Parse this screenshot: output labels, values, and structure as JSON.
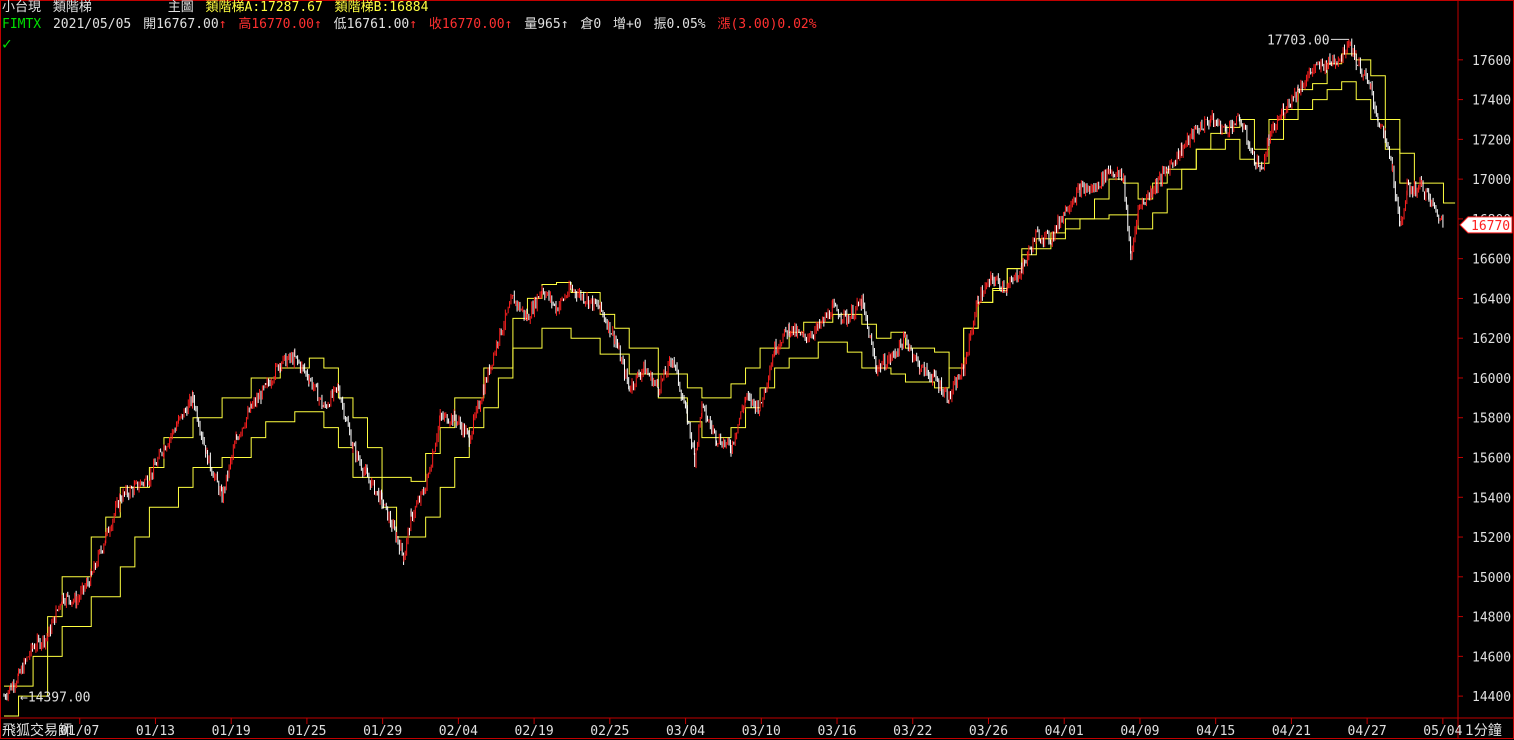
{
  "header": {
    "symbol_name": "小台現",
    "indicator_name": "類階梯",
    "panel_label": "主圖",
    "ladder_a": "類階梯A:17287.67",
    "ladder_b": "類階梯B:16884",
    "code": "FIMTX",
    "date": "2021/05/05",
    "open": "開16767.00",
    "high": "高16770.00",
    "low": "低16761.00",
    "close": "收16770.00",
    "volume": "量965",
    "open_interest": "倉0",
    "oi_change": "增+0",
    "amplitude": "振0.05%",
    "change": "漲(3.00)0.02%",
    "arrow": "↑"
  },
  "footer": {
    "brand": "飛狐交易師",
    "interval": "1分鐘"
  },
  "colors": {
    "background": "#000000",
    "axis": "#c00000",
    "text": "#e0e0e0",
    "up": "#ff2020",
    "down": "#ffffff",
    "ladder": "#ffff40",
    "code": "#00e000"
  },
  "chart_data": {
    "type": "candlestick",
    "title": "小台現 類階梯",
    "ylim": [
      14300,
      17750
    ],
    "y_ticks": [
      14400,
      14600,
      14800,
      15000,
      15200,
      15400,
      15600,
      15800,
      16000,
      16200,
      16400,
      16600,
      16800,
      17000,
      17200,
      17400,
      17600
    ],
    "x_ticks": [
      "01/07",
      "01/13",
      "01/19",
      "01/25",
      "01/29",
      "02/04",
      "02/19",
      "02/25",
      "03/04",
      "03/10",
      "03/16",
      "03/22",
      "03/26",
      "04/01",
      "04/09",
      "04/15",
      "04/21",
      "04/27",
      "05/04"
    ],
    "max_label": "17703.00",
    "min_label": "14397.00",
    "last_price": "16770",
    "price_path": [
      [
        0,
        14400
      ],
      [
        0.01,
        14500
      ],
      [
        0.02,
        14650
      ],
      [
        0.03,
        14700
      ],
      [
        0.04,
        14900
      ],
      [
        0.05,
        14880
      ],
      [
        0.06,
        15000
      ],
      [
        0.07,
        15200
      ],
      [
        0.08,
        15400
      ],
      [
        0.09,
        15450
      ],
      [
        0.1,
        15500
      ],
      [
        0.11,
        15650
      ],
      [
        0.12,
        15780
      ],
      [
        0.13,
        15900
      ],
      [
        0.14,
        15600
      ],
      [
        0.15,
        15400
      ],
      [
        0.16,
        15700
      ],
      [
        0.17,
        15850
      ],
      [
        0.18,
        15950
      ],
      [
        0.19,
        16080
      ],
      [
        0.2,
        16100
      ],
      [
        0.21,
        16000
      ],
      [
        0.22,
        15850
      ],
      [
        0.23,
        15950
      ],
      [
        0.24,
        15650
      ],
      [
        0.25,
        15500
      ],
      [
        0.26,
        15380
      ],
      [
        0.27,
        15200
      ],
      [
        0.275,
        15100
      ],
      [
        0.28,
        15300
      ],
      [
        0.29,
        15450
      ],
      [
        0.3,
        15800
      ],
      [
        0.31,
        15800
      ],
      [
        0.32,
        15700
      ],
      [
        0.33,
        15950
      ],
      [
        0.34,
        16200
      ],
      [
        0.35,
        16400
      ],
      [
        0.36,
        16300
      ],
      [
        0.37,
        16450
      ],
      [
        0.38,
        16350
      ],
      [
        0.39,
        16450
      ],
      [
        0.4,
        16400
      ],
      [
        0.41,
        16350
      ],
      [
        0.42,
        16200
      ],
      [
        0.43,
        15950
      ],
      [
        0.44,
        16050
      ],
      [
        0.45,
        15950
      ],
      [
        0.46,
        16100
      ],
      [
        0.47,
        15800
      ],
      [
        0.475,
        15600
      ],
      [
        0.48,
        15850
      ],
      [
        0.49,
        15700
      ],
      [
        0.5,
        15650
      ],
      [
        0.51,
        15900
      ],
      [
        0.52,
        15850
      ],
      [
        0.53,
        16150
      ],
      [
        0.54,
        16250
      ],
      [
        0.55,
        16200
      ],
      [
        0.56,
        16250
      ],
      [
        0.57,
        16350
      ],
      [
        0.58,
        16300
      ],
      [
        0.59,
        16380
      ],
      [
        0.6,
        16050
      ],
      [
        0.61,
        16100
      ],
      [
        0.62,
        16200
      ],
      [
        0.63,
        16050
      ],
      [
        0.64,
        16000
      ],
      [
        0.65,
        15900
      ],
      [
        0.66,
        16050
      ],
      [
        0.67,
        16400
      ],
      [
        0.68,
        16500
      ],
      [
        0.69,
        16450
      ],
      [
        0.7,
        16550
      ],
      [
        0.71,
        16720
      ],
      [
        0.72,
        16700
      ],
      [
        0.73,
        16850
      ],
      [
        0.74,
        16950
      ],
      [
        0.75,
        16950
      ],
      [
        0.76,
        17050
      ],
      [
        0.77,
        17000
      ],
      [
        0.775,
        16600
      ],
      [
        0.78,
        16850
      ],
      [
        0.79,
        16950
      ],
      [
        0.8,
        17050
      ],
      [
        0.81,
        17150
      ],
      [
        0.82,
        17250
      ],
      [
        0.83,
        17300
      ],
      [
        0.84,
        17250
      ],
      [
        0.85,
        17300
      ],
      [
        0.86,
        17100
      ],
      [
        0.865,
        17050
      ],
      [
        0.87,
        17200
      ],
      [
        0.88,
        17350
      ],
      [
        0.89,
        17450
      ],
      [
        0.9,
        17550
      ],
      [
        0.91,
        17580
      ],
      [
        0.92,
        17620
      ],
      [
        0.925,
        17700
      ],
      [
        0.93,
        17600
      ],
      [
        0.94,
        17450
      ],
      [
        0.945,
        17300
      ],
      [
        0.95,
        17200
      ],
      [
        0.955,
        17050
      ],
      [
        0.96,
        16750
      ],
      [
        0.965,
        16950
      ],
      [
        0.97,
        16950
      ],
      [
        0.975,
        16970
      ],
      [
        0.98,
        16900
      ],
      [
        0.99,
        16770
      ]
    ],
    "series": [
      {
        "name": "類階梯A",
        "steps": [
          [
            0,
            14450
          ],
          [
            0.02,
            14600
          ],
          [
            0.03,
            14800
          ],
          [
            0.04,
            15000
          ],
          [
            0.06,
            15200
          ],
          [
            0.07,
            15300
          ],
          [
            0.08,
            15450
          ],
          [
            0.1,
            15550
          ],
          [
            0.11,
            15700
          ],
          [
            0.13,
            15800
          ],
          [
            0.15,
            15900
          ],
          [
            0.17,
            16000
          ],
          [
            0.19,
            16050
          ],
          [
            0.21,
            16100
          ],
          [
            0.22,
            16050
          ],
          [
            0.23,
            15900
          ],
          [
            0.24,
            15800
          ],
          [
            0.25,
            15650
          ],
          [
            0.26,
            15500
          ],
          [
            0.28,
            15480
          ],
          [
            0.29,
            15620
          ],
          [
            0.3,
            15750
          ],
          [
            0.31,
            15900
          ],
          [
            0.33,
            16050
          ],
          [
            0.35,
            16300
          ],
          [
            0.36,
            16400
          ],
          [
            0.37,
            16470
          ],
          [
            0.38,
            16480
          ],
          [
            0.39,
            16430
          ],
          [
            0.41,
            16320
          ],
          [
            0.42,
            16250
          ],
          [
            0.43,
            16150
          ],
          [
            0.45,
            16020
          ],
          [
            0.47,
            15950
          ],
          [
            0.48,
            15900
          ],
          [
            0.5,
            15970
          ],
          [
            0.51,
            16050
          ],
          [
            0.52,
            16150
          ],
          [
            0.54,
            16230
          ],
          [
            0.55,
            16280
          ],
          [
            0.57,
            16320
          ],
          [
            0.59,
            16270
          ],
          [
            0.6,
            16200
          ],
          [
            0.61,
            16230
          ],
          [
            0.62,
            16150
          ],
          [
            0.64,
            16130
          ],
          [
            0.65,
            16050
          ],
          [
            0.66,
            16250
          ],
          [
            0.67,
            16380
          ],
          [
            0.68,
            16440
          ],
          [
            0.69,
            16550
          ],
          [
            0.7,
            16650
          ],
          [
            0.72,
            16730
          ],
          [
            0.73,
            16800
          ],
          [
            0.75,
            16900
          ],
          [
            0.76,
            17000
          ],
          [
            0.77,
            16980
          ],
          [
            0.78,
            16900
          ],
          [
            0.79,
            16980
          ],
          [
            0.8,
            17050
          ],
          [
            0.82,
            17150
          ],
          [
            0.83,
            17230
          ],
          [
            0.84,
            17260
          ],
          [
            0.85,
            17300
          ],
          [
            0.86,
            17150
          ],
          [
            0.87,
            17300
          ],
          [
            0.88,
            17350
          ],
          [
            0.89,
            17450
          ],
          [
            0.9,
            17480
          ],
          [
            0.91,
            17580
          ],
          [
            0.92,
            17630
          ],
          [
            0.93,
            17600
          ],
          [
            0.94,
            17520
          ],
          [
            0.95,
            17300
          ],
          [
            0.96,
            17130
          ],
          [
            0.97,
            16980
          ],
          [
            0.99,
            16880
          ]
        ]
      },
      {
        "name": "類階梯B",
        "steps": [
          [
            0,
            14300
          ],
          [
            0.01,
            14400
          ],
          [
            0.03,
            14600
          ],
          [
            0.04,
            14750
          ],
          [
            0.06,
            14900
          ],
          [
            0.08,
            15050
          ],
          [
            0.09,
            15200
          ],
          [
            0.1,
            15350
          ],
          [
            0.12,
            15450
          ],
          [
            0.13,
            15550
          ],
          [
            0.15,
            15600
          ],
          [
            0.17,
            15700
          ],
          [
            0.18,
            15780
          ],
          [
            0.2,
            15830
          ],
          [
            0.22,
            15750
          ],
          [
            0.23,
            15650
          ],
          [
            0.24,
            15500
          ],
          [
            0.26,
            15350
          ],
          [
            0.27,
            15200
          ],
          [
            0.29,
            15300
          ],
          [
            0.3,
            15450
          ],
          [
            0.31,
            15600
          ],
          [
            0.32,
            15750
          ],
          [
            0.33,
            15850
          ],
          [
            0.34,
            16000
          ],
          [
            0.35,
            16150
          ],
          [
            0.37,
            16250
          ],
          [
            0.39,
            16200
          ],
          [
            0.41,
            16120
          ],
          [
            0.43,
            16020
          ],
          [
            0.45,
            15900
          ],
          [
            0.47,
            15780
          ],
          [
            0.48,
            15700
          ],
          [
            0.5,
            15750
          ],
          [
            0.51,
            15850
          ],
          [
            0.52,
            15950
          ],
          [
            0.53,
            16050
          ],
          [
            0.54,
            16100
          ],
          [
            0.56,
            16180
          ],
          [
            0.58,
            16130
          ],
          [
            0.59,
            16050
          ],
          [
            0.61,
            16020
          ],
          [
            0.62,
            15980
          ],
          [
            0.64,
            15950
          ],
          [
            0.65,
            16050
          ],
          [
            0.66,
            16250
          ],
          [
            0.67,
            16380
          ],
          [
            0.68,
            16450
          ],
          [
            0.69,
            16550
          ],
          [
            0.7,
            16620
          ],
          [
            0.71,
            16700
          ],
          [
            0.73,
            16750
          ],
          [
            0.74,
            16800
          ],
          [
            0.76,
            16820
          ],
          [
            0.78,
            16750
          ],
          [
            0.79,
            16830
          ],
          [
            0.8,
            16950
          ],
          [
            0.81,
            17050
          ],
          [
            0.82,
            17150
          ],
          [
            0.84,
            17200
          ],
          [
            0.85,
            17100
          ],
          [
            0.86,
            17080
          ],
          [
            0.87,
            17200
          ],
          [
            0.88,
            17300
          ],
          [
            0.89,
            17350
          ],
          [
            0.9,
            17400
          ],
          [
            0.91,
            17450
          ],
          [
            0.92,
            17490
          ],
          [
            0.93,
            17400
          ],
          [
            0.94,
            17300
          ],
          [
            0.95,
            17150
          ],
          [
            0.96,
            16980
          ]
        ]
      }
    ]
  }
}
